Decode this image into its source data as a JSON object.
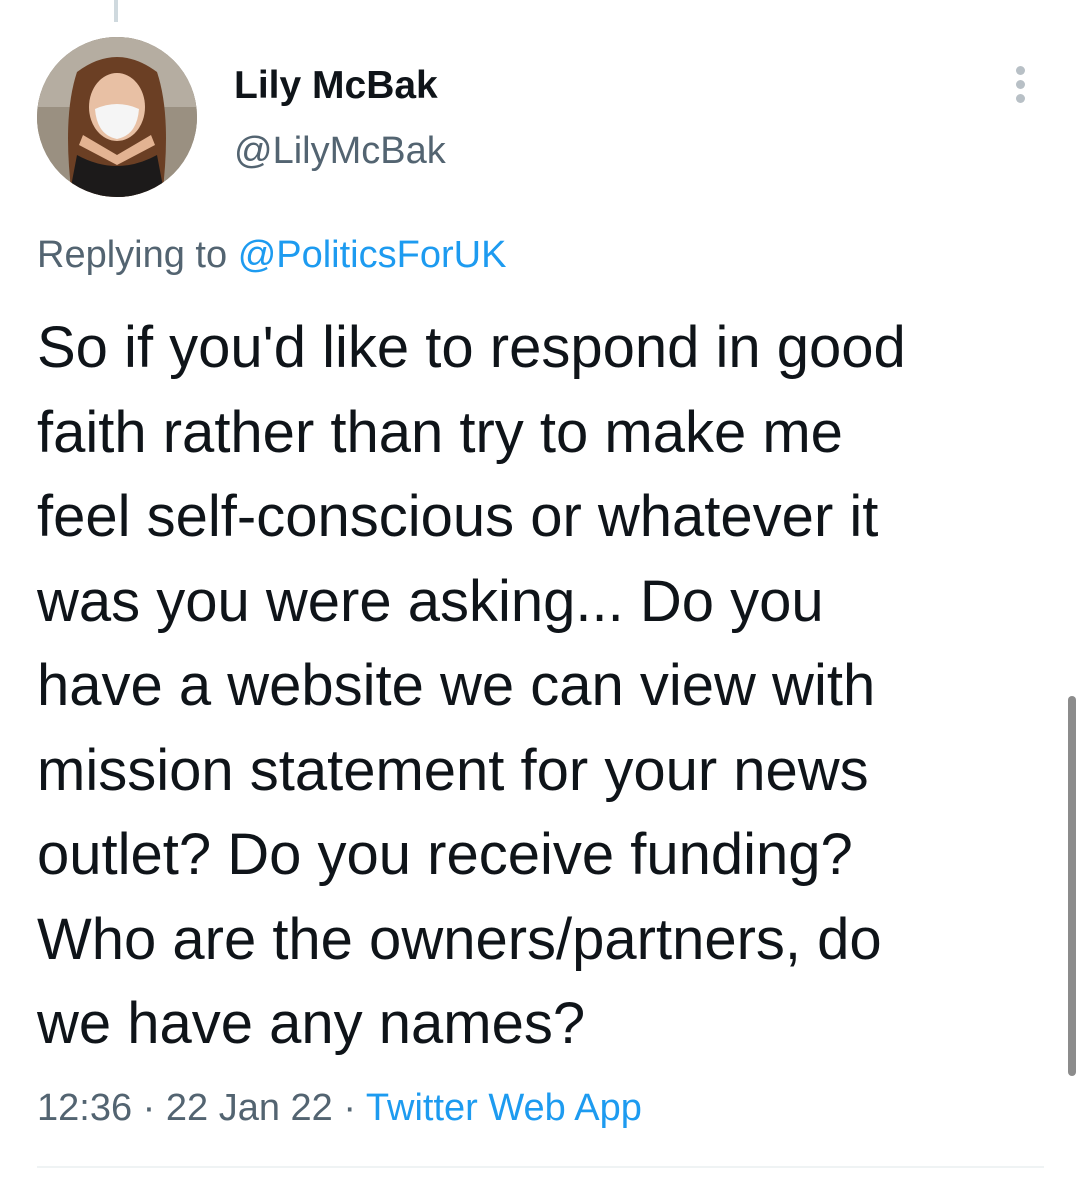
{
  "tweet": {
    "author": {
      "display_name": "Lily McBak",
      "handle": "@LilyMcBak",
      "avatar_icon": "avatar-photo"
    },
    "reply": {
      "prefix": "Replying to",
      "mention": "@PoliticsForUK"
    },
    "text_lines": [
      "So if you'd like to respond in good",
      "faith rather than try to make me",
      "feel self-conscious or whatever it",
      "was you were asking... Do you",
      "have a website we can view with",
      "mission statement for your news",
      "outlet? Do you receive funding?",
      "Who are the owners/partners, do",
      "we have any names?"
    ],
    "time": "12:36",
    "separator": "·",
    "date": "22 Jan 22",
    "source": "Twitter Web App"
  },
  "icons": {
    "more": "more-vertical-icon"
  },
  "colors": {
    "text": "#0f1419",
    "secondary": "#536471",
    "link": "#1d9bf0",
    "divider": "#eff3f4"
  }
}
